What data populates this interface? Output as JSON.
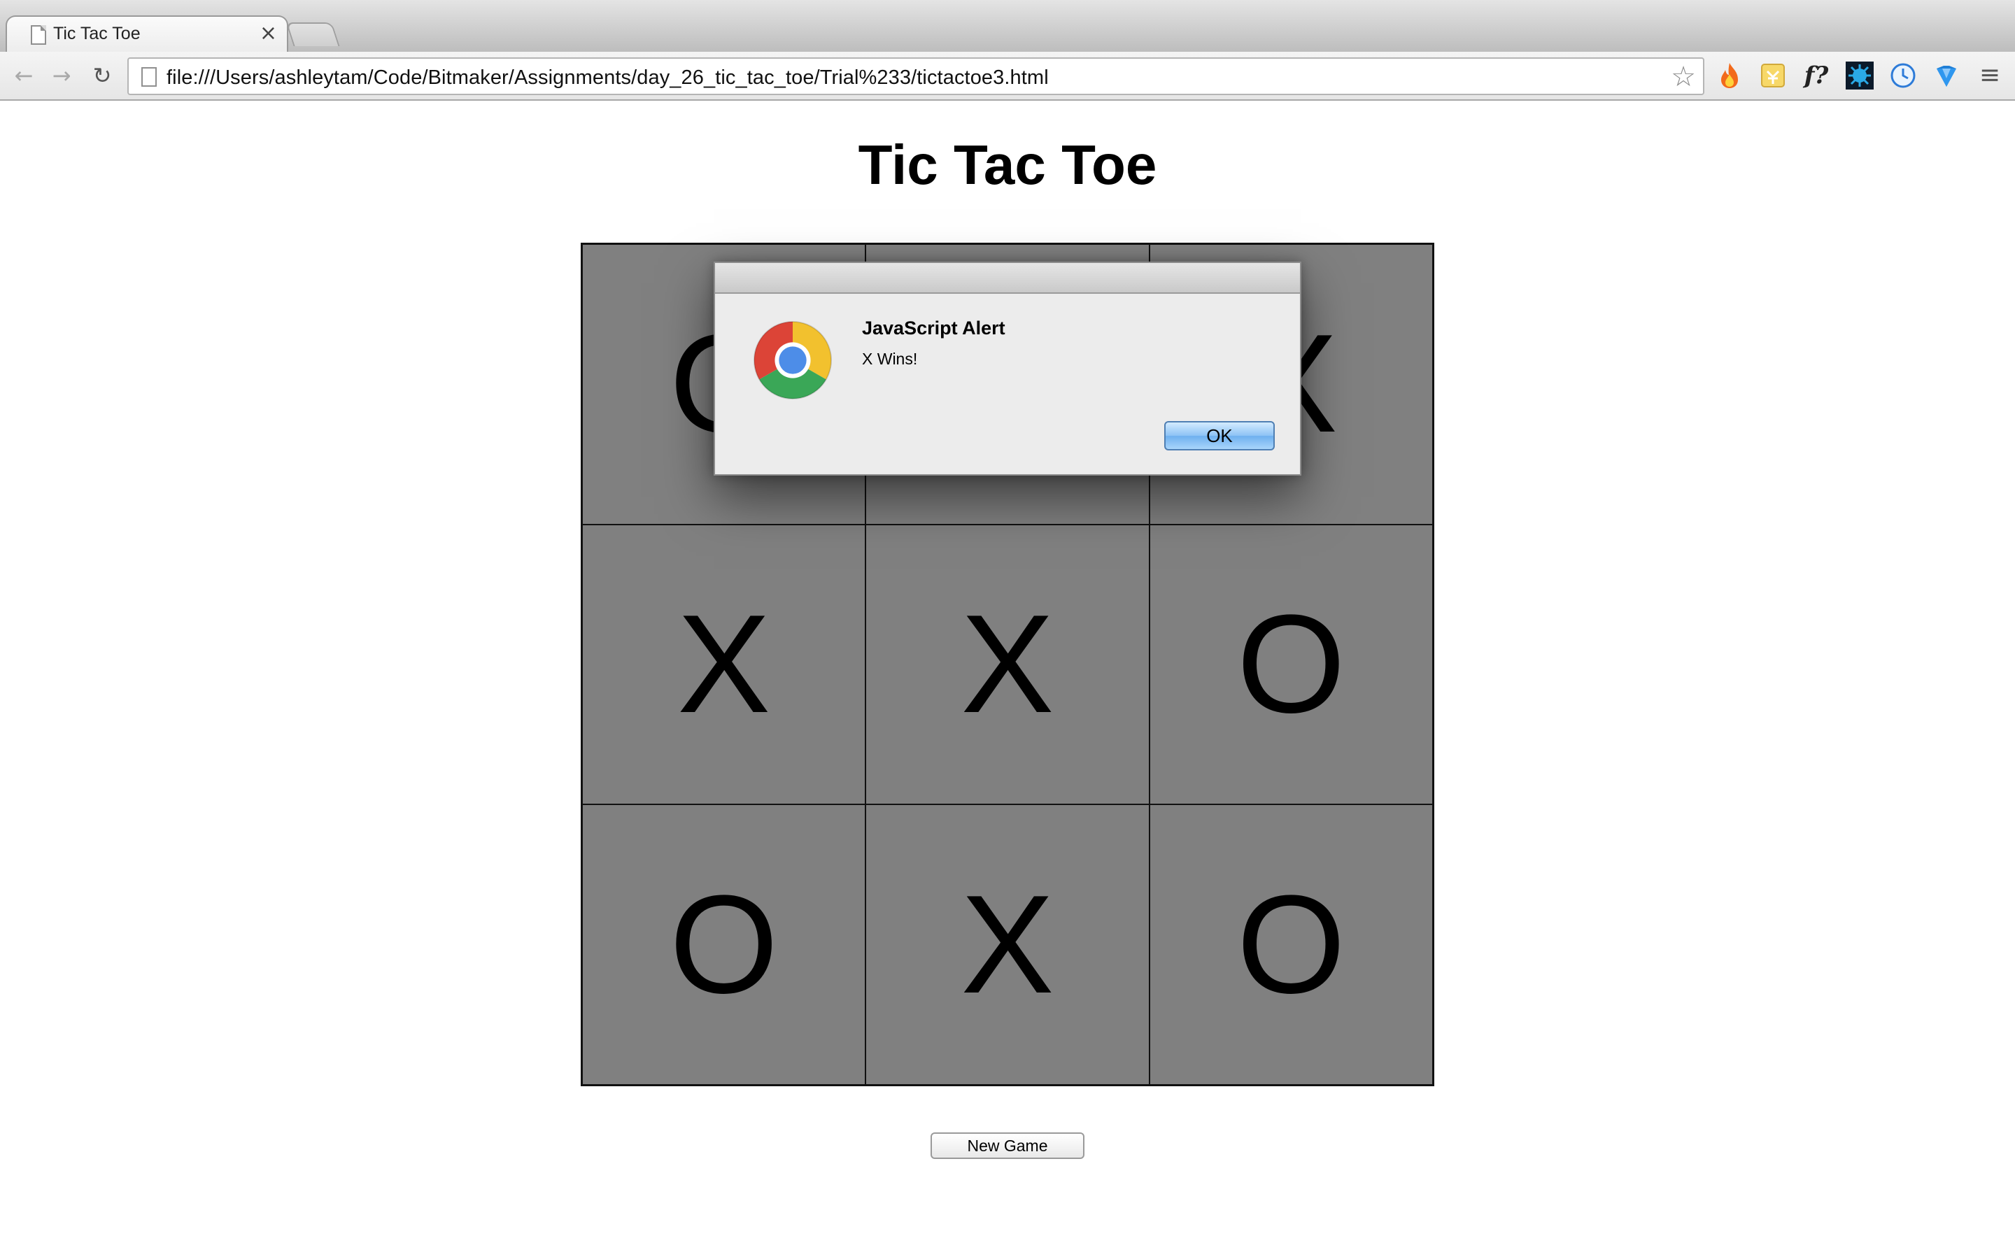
{
  "browser": {
    "tab_title": "Tic Tac Toe",
    "tab_close": "×",
    "url": "file:///Users/ashleytam/Code/Bitmaker/Assignments/day_26_tic_tac_toe/Trial%233/tictactoe3.html",
    "nav": {
      "back": "←",
      "forward": "→",
      "reload": "↻"
    },
    "star": "☆",
    "extensions": [
      "fire-icon",
      "clipboard-icon",
      "fn-icon",
      "bug-icon",
      "clock-icon",
      "gem-icon"
    ],
    "extension_fn_label": "f?",
    "menu": "≡"
  },
  "page": {
    "title": "Tic Tac Toe",
    "board": [
      [
        "O",
        "",
        "X"
      ],
      [
        "X",
        "X",
        "O"
      ],
      [
        "O",
        "X",
        "O"
      ]
    ],
    "new_game_label": "New Game",
    "cell_color": "#808080"
  },
  "alert": {
    "title": "JavaScript Alert",
    "message": "X Wins!",
    "ok_label": "OK"
  }
}
